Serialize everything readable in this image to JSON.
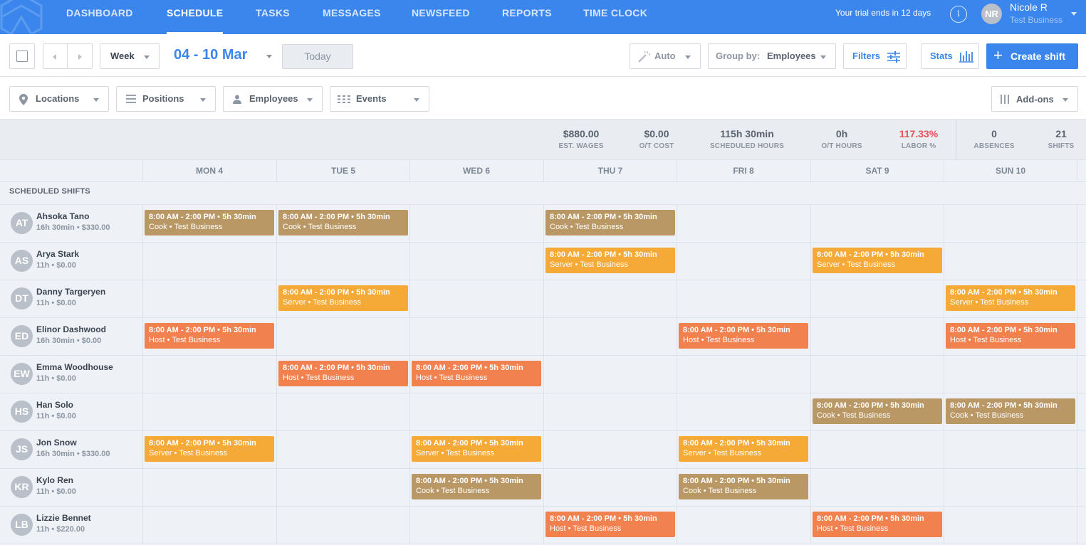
{
  "nav": {
    "tabs": [
      "DASHBOARD",
      "SCHEDULE",
      "TASKS",
      "MESSAGES",
      "NEWSFEED",
      "REPORTS",
      "TIME CLOCK"
    ],
    "active": "SCHEDULE",
    "trial_text": "Your trial ends in 12 days",
    "info_icon": "i",
    "user": {
      "initials": "NR",
      "name": "Nicole R",
      "business": "Test Business"
    }
  },
  "toolbar": {
    "view": "Week",
    "date_range": "04 - 10 Mar",
    "today": "Today",
    "auto": "Auto",
    "group_by_label": "Group by:",
    "group_by_value": "Employees",
    "filters": "Filters",
    "stats": "Stats",
    "create_shift": "Create shift",
    "create_icon": "+"
  },
  "filters": {
    "locations": "Locations",
    "positions": "Positions",
    "employees": "Employees",
    "events": "Events",
    "addons": "Add-ons"
  },
  "stats": [
    {
      "value": "$880.00",
      "label": "EST. WAGES",
      "color": "normal"
    },
    {
      "value": "$0.00",
      "label": "O/T COST",
      "color": "normal"
    },
    {
      "value": "115h 30min",
      "label": "SCHEDULED HOURS",
      "color": "normal"
    },
    {
      "value": "0h",
      "label": "O/T HOURS",
      "color": "normal"
    },
    {
      "value": "117.33%",
      "label": "LABOR %",
      "color": "red"
    },
    {
      "value": "0",
      "label": "ABSENCES",
      "color": "normal"
    },
    {
      "value": "21",
      "label": "SHIFTS",
      "color": "normal"
    }
  ],
  "days": [
    "MON 4",
    "TUE 5",
    "WED 6",
    "THU 7",
    "FRI 8",
    "SAT 9",
    "SUN 10"
  ],
  "section_label": "SCHEDULED SHIFTS",
  "colors": {
    "Cook": "#b99866",
    "Server": "#f5a937",
    "Host": "#f28150"
  },
  "shift_time": "8:00 AM - 2:00 PM • 5h 30min",
  "business": "Test Business",
  "employees": [
    {
      "initials": "AT",
      "name": "Ahsoka Tano",
      "info": "16h 30min • $330.00",
      "shifts": [
        "Cook",
        "Cook",
        null,
        "Cook",
        null,
        null,
        null
      ]
    },
    {
      "initials": "AS",
      "name": "Arya Stark",
      "info": "11h • $0.00",
      "shifts": [
        null,
        null,
        null,
        "Server",
        null,
        "Server",
        null
      ]
    },
    {
      "initials": "DT",
      "name": "Danny Targeryen",
      "info": "11h • $0.00",
      "shifts": [
        null,
        "Server",
        null,
        null,
        null,
        null,
        "Server"
      ]
    },
    {
      "initials": "ED",
      "name": "Elinor Dashwood",
      "info": "16h 30min • $0.00",
      "shifts": [
        "Host",
        null,
        null,
        null,
        "Host",
        null,
        "Host"
      ]
    },
    {
      "initials": "EW",
      "name": "Emma Woodhouse",
      "info": "11h • $0.00",
      "shifts": [
        null,
        "Host",
        "Host",
        null,
        null,
        null,
        null
      ]
    },
    {
      "initials": "HS",
      "name": "Han Solo",
      "info": "11h • $0.00",
      "shifts": [
        null,
        null,
        null,
        null,
        null,
        "Cook",
        "Cook"
      ]
    },
    {
      "initials": "JS",
      "name": "Jon Snow",
      "info": "16h 30min • $330.00",
      "shifts": [
        "Server",
        null,
        "Server",
        null,
        "Server",
        null,
        null
      ]
    },
    {
      "initials": "KR",
      "name": "Kylo Ren",
      "info": "11h • $0.00",
      "shifts": [
        null,
        null,
        "Cook",
        null,
        "Cook",
        null,
        null
      ]
    },
    {
      "initials": "LB",
      "name": "Lizzie Bennet",
      "info": "11h • $220.00",
      "shifts": [
        null,
        null,
        null,
        "Host",
        null,
        "Host",
        null
      ]
    }
  ]
}
